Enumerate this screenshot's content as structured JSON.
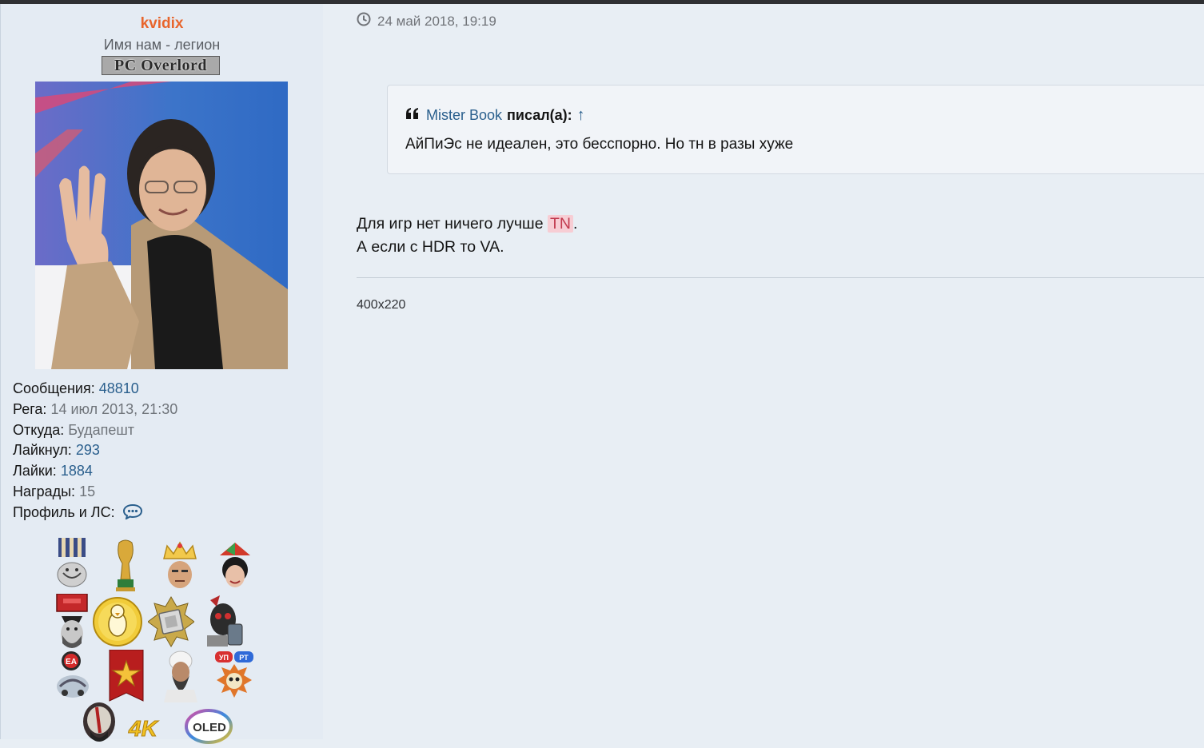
{
  "author": {
    "username": "kvidix",
    "title": "Имя нам - легион",
    "rank_banner": "PC Overlord"
  },
  "stats": [
    {
      "label": "Сообщения:",
      "value": "48810",
      "kind": "link"
    },
    {
      "label": "Рега:",
      "value": "14 июл 2013, 21:30",
      "kind": "muted"
    },
    {
      "label": "Откуда:",
      "value": "Будапешт",
      "kind": "muted"
    },
    {
      "label": "Лайкнул:",
      "value": "293",
      "kind": "link"
    },
    {
      "label": "Лайки:",
      "value": "1884",
      "kind": "link"
    },
    {
      "label": "Награды:",
      "value": "15",
      "kind": "muted"
    },
    {
      "label": "Профиль и ЛС:",
      "value": "",
      "kind": "icon",
      "icon": "chat-bubble-icon"
    }
  ],
  "awards": [
    "medal-troll-icon",
    "world-cup-trophy-icon",
    "crown-face-icon",
    "propeller-hat-face-icon",
    "pirate-medal-icon",
    "gold-penguin-coin-icon",
    "cpu-star-badge-icon",
    "skull-mech-icon",
    "ea-car-badge-icon",
    "red-star-ribbon-icon",
    "bearded-man-icon",
    "up-pt-skull-badge-icon",
    "kratos-icon",
    "4k-logo-icon",
    "oled-logo-icon"
  ],
  "post": {
    "timestamp": "24 май 2018, 19:19",
    "quote": {
      "author": "Mister Book",
      "wrote_label": "писал(а):",
      "arrow": "↑",
      "text": "АйПиЭс не идеален, это бесспорно. Но тн в разы хуже"
    },
    "line1_before": "Для игр нет ничего лучше ",
    "line1_highlight": "TN",
    "line1_after": ".",
    "line2": "А если с HDR то VA.",
    "signature": "400x220"
  },
  "colors": {
    "username": "#e8652c",
    "link": "#2a5f8d",
    "highlight_bg": "#f7cdd4",
    "highlight_text": "#c23a4e",
    "page_bg": "#e8eef4"
  }
}
